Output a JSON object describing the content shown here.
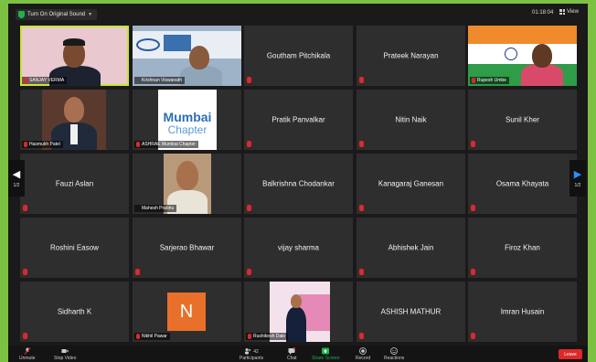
{
  "topbar": {
    "original_sound_label": "Turn On Original Sound",
    "timer": "01:18:04",
    "view_label": "View"
  },
  "nav": {
    "left_page": "1/2",
    "right_page": "1/2"
  },
  "participants": [
    {
      "name": "SANJAY VERMA"
    },
    {
      "name": "Krishnan Viswanath"
    },
    {
      "name": "Goutham Pitchikala"
    },
    {
      "name": "Prateek Narayan"
    },
    {
      "name": "Rupesh Umbe"
    },
    {
      "name": "Hasmukh Patel"
    },
    {
      "name": "ASHRAE Mumbai Chapter",
      "logo_line1": "Mumbai",
      "logo_line2": "Chapter"
    },
    {
      "name": "Pratik Panvalkar"
    },
    {
      "name": "Nitin Naik"
    },
    {
      "name": "Sunil Kher"
    },
    {
      "name": "Fauzi Aslan"
    },
    {
      "name": "Mahesh Prabhu"
    },
    {
      "name": "Balkrishna Chodankar"
    },
    {
      "name": "Kanagaraj Ganesan"
    },
    {
      "name": "Osama Khayata"
    },
    {
      "name": "Roshini Easow"
    },
    {
      "name": "Sarjerao Bhawar"
    },
    {
      "name": "vijay sharma"
    },
    {
      "name": "Abhishek Jain"
    },
    {
      "name": "Firoz Khan"
    },
    {
      "name": "Sidharth K"
    },
    {
      "name": "Nikhil Pawar",
      "avatar_letter": "N"
    },
    {
      "name": "Rushikesh Dale"
    },
    {
      "name": "ASHISH MATHUR"
    },
    {
      "name": "Imran Husain"
    }
  ],
  "toolbar": {
    "unmute": "Unmute",
    "stop_video": "Stop Video",
    "participants": "Participants",
    "participants_count": "42",
    "chat": "Chat",
    "share_screen": "Share Screen",
    "record": "Record",
    "reactions": "Reactions",
    "leave": "Leave"
  },
  "colors": {
    "active_speaker": "#c8e632",
    "share_green": "#22b14c",
    "leave_red": "#e02828",
    "accent_blue": "#2d8cff",
    "avatar_orange": "#e8702a"
  }
}
